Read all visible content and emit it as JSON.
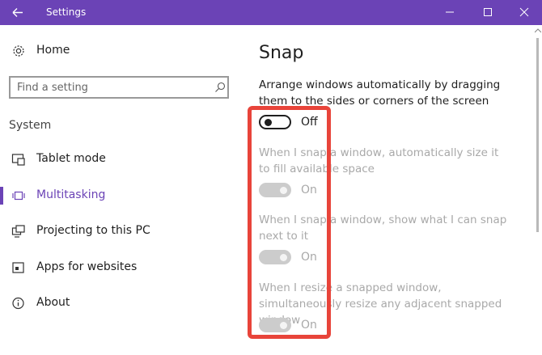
{
  "window": {
    "title": "Settings"
  },
  "sidebar": {
    "home_label": "Home",
    "search_placeholder": "Find a setting",
    "section_label": "System",
    "items": [
      {
        "label": "Tablet mode",
        "icon": "tablet-mode-icon"
      },
      {
        "label": "Multitasking",
        "icon": "multitasking-icon",
        "active": true
      },
      {
        "label": "Projecting to this PC",
        "icon": "projecting-icon"
      },
      {
        "label": "Apps for websites",
        "icon": "apps-for-websites-icon"
      },
      {
        "label": "About",
        "icon": "info-icon"
      }
    ]
  },
  "main": {
    "title": "Snap",
    "snap_description": "Arrange windows automatically by dragging them to the sides or corners of the screen",
    "snap_toggle_state": "Off",
    "options": [
      {
        "description": "When I snap a window, automatically size it to fill available space",
        "state": "On"
      },
      {
        "description": "When I snap a window, show what I can snap next to it",
        "state": "On"
      },
      {
        "description": "When I resize a snapped window, simultaneously resize any adjacent snapped window",
        "state": "On"
      }
    ]
  },
  "colors": {
    "accent": "#6b43b6",
    "highlight": "#e8443a",
    "disabled_text": "#a9a9a9"
  }
}
